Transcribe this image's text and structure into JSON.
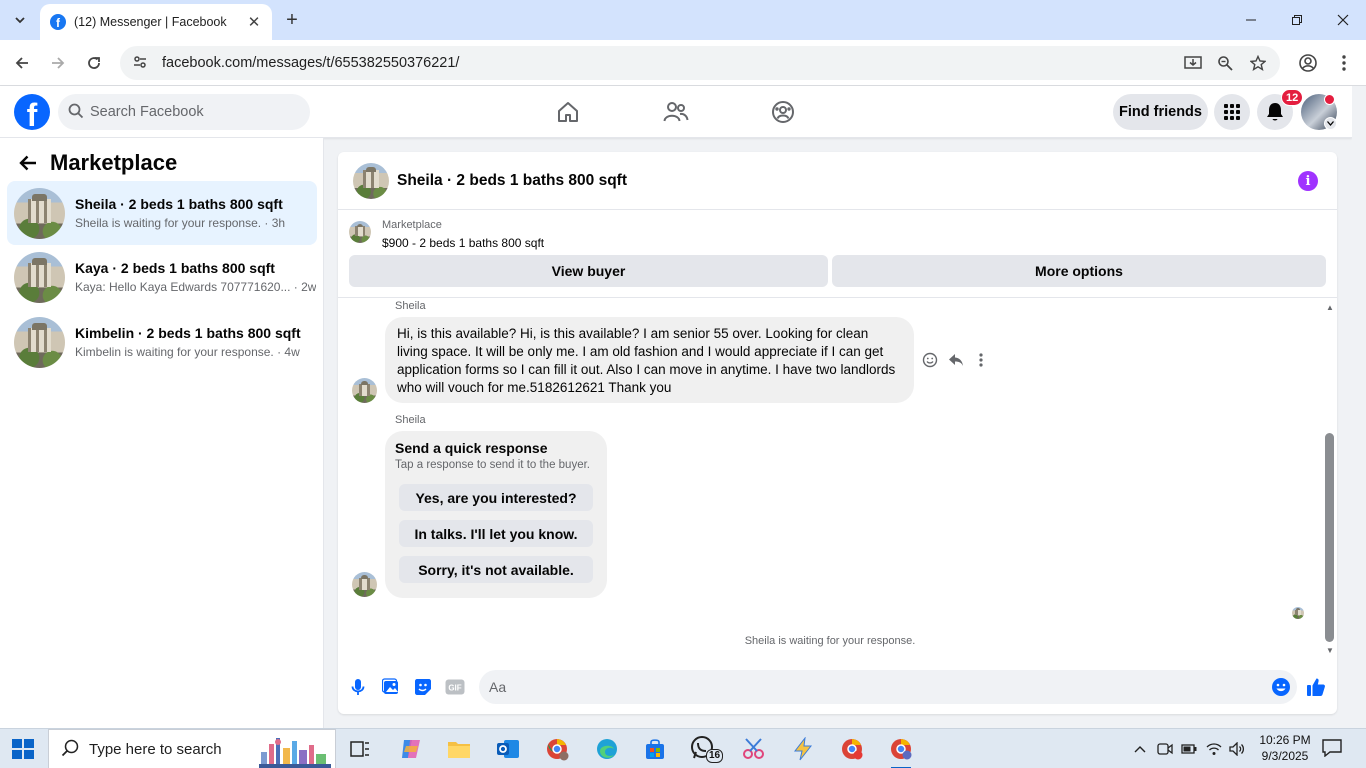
{
  "browser": {
    "tab_title": "(12) Messenger | Facebook",
    "url": "facebook.com/messages/t/655382550376221/"
  },
  "fb": {
    "search_placeholder": "Search Facebook",
    "find_friends": "Find friends",
    "notification_count": "12"
  },
  "marketplace": {
    "title": "Marketplace",
    "conversations": [
      {
        "name": "Sheila · 2 beds 1 baths 800 sqft",
        "preview": "Sheila is waiting for your response. · 3h"
      },
      {
        "name": "Kaya · 2 beds 1 baths 800 sqft",
        "preview": "Kaya: Hello Kaya Edwards 707771620... · 2w"
      },
      {
        "name": "Kimbelin · 2 beds 1 baths 800 sqft",
        "preview": "Kimbelin is waiting for your response. · 4w"
      }
    ]
  },
  "chat": {
    "title": "Sheila · 2 beds 1 baths 800 sqft",
    "listing": {
      "source": "Marketplace",
      "summary": "$900 - 2 beds 1 baths 800 sqft",
      "view_buyer": "View buyer",
      "more_options": "More options"
    },
    "messages": [
      {
        "sender": "Sheila",
        "text": "Hi, is this available? Hi, is this available? I am senior 55 over. Looking for clean living space. It will be only me. I am old fashion and I would appreciate if I can get application forms so I can fill it out. Also I can move in anytime. I have two landlords who will vouch for me.5182612621 ⁠⁠⁠Thank you"
      },
      {
        "sender": "Sheila",
        "quick_response_title": "Send a quick response",
        "quick_response_sub": "Tap a response to send it to the buyer.",
        "options": [
          "Yes, are you interested?",
          "In talks. I'll let you know.",
          "Sorry, it's not available."
        ]
      }
    ],
    "waiting_note": "Sheila is waiting for your response.",
    "input_placeholder": "Aa"
  },
  "taskbar": {
    "search_placeholder": "Type here to search",
    "whatsapp_badge": "16",
    "time": "10:26 PM",
    "date": "9/3/2025"
  },
  "colors": {
    "fb_blue": "#0866ff",
    "active_conv": "#e7f3ff",
    "notification_red": "#e41e3f",
    "info_purple": "#a033ff"
  }
}
